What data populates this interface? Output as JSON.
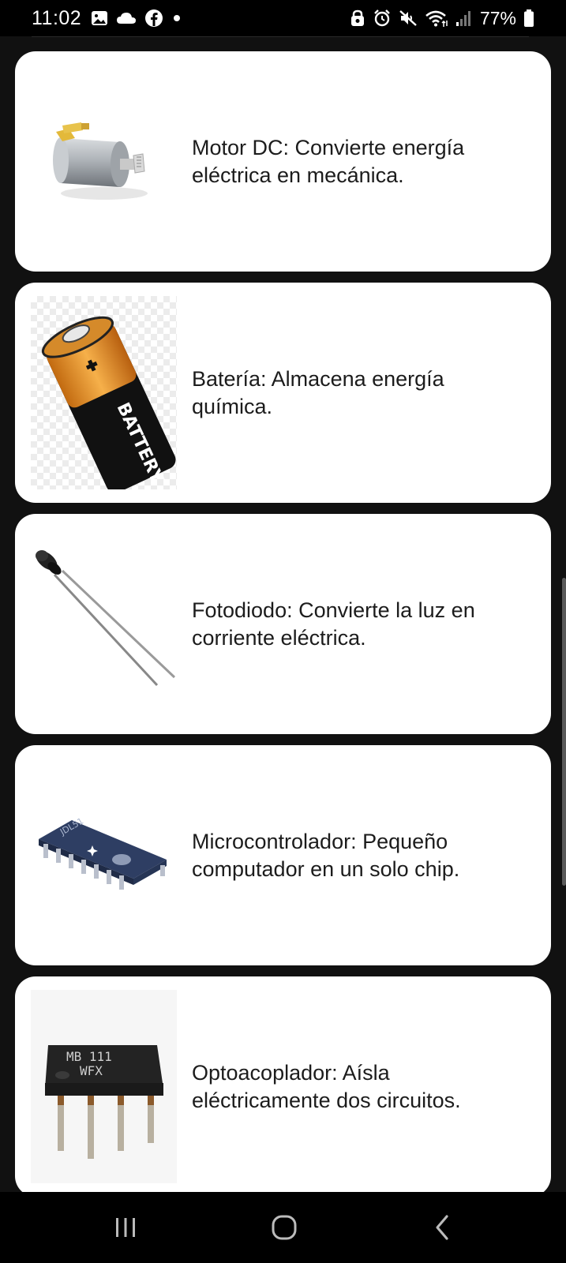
{
  "status_bar": {
    "time": "11:02",
    "battery_percent": "77%",
    "left_icons": [
      "gallery-icon",
      "cloud-icon",
      "facebook-icon",
      "dot-icon"
    ],
    "right_icons": [
      "vpn-lock-icon",
      "alarm-icon",
      "mute-icon",
      "wifi-icon",
      "signal-icon",
      "battery-icon"
    ]
  },
  "cards": [
    {
      "description": "Motor DC: Convierte energía eléctrica en mecánica.",
      "image": "dc-motor-image"
    },
    {
      "description": "Batería: Almacena energía química.",
      "image": "battery-image",
      "image_text": "BATTERY"
    },
    {
      "description": "Fotodiodo: Convierte la luz en corriente eléctrica.",
      "image": "photodiode-image"
    },
    {
      "description": "Microcontrolador: Pequeño computador en un solo chip.",
      "image": "microcontroller-image",
      "image_text": "JDL51"
    },
    {
      "description": "Optoacoplador: Aísla eléctricamente dos circuitos.",
      "image": "optocoupler-image",
      "image_text_line1": "MB 111",
      "image_text_line2": "WFX"
    }
  ],
  "nav_bar": {
    "buttons": [
      "recent-apps-icon",
      "home-icon",
      "back-icon"
    ]
  },
  "colors": {
    "background": "#111111",
    "card": "#ffffff",
    "text": "#1c1c1c",
    "system_bar": "#000000"
  }
}
